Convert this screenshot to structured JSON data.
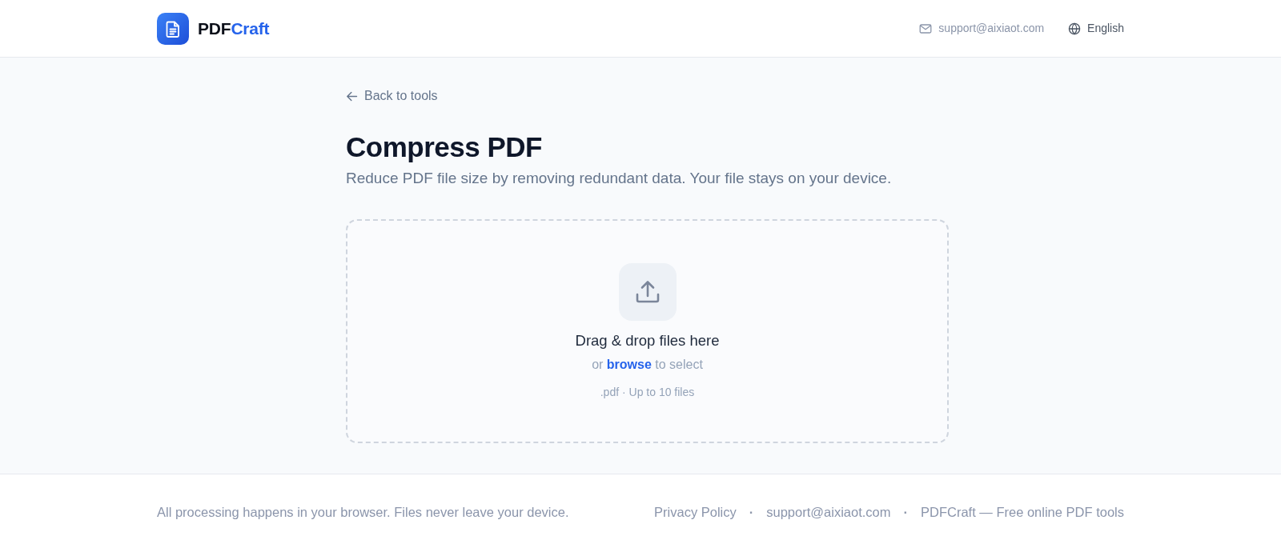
{
  "header": {
    "logo": {
      "brand": "PDF",
      "accent": "Craft"
    },
    "contact_email": "support@aixiaot.com",
    "language": "English"
  },
  "back_link": "Back to tools",
  "page": {
    "title": "Compress PDF",
    "subtitle": "Reduce PDF file size by removing redundant data. Your file stays on your device."
  },
  "dropzone": {
    "heading": "Drag & drop files here",
    "hint_before": "or",
    "link": "browse",
    "hint_after": "to select",
    "accepts": ".pdf · Up to 10 files"
  },
  "footer": {
    "note": "All processing happens in your browser. Files never leave your device.",
    "items": [
      {
        "kind": "link",
        "text": "Privacy Policy"
      },
      {
        "kind": "separator",
        "text": "·"
      },
      {
        "kind": "link",
        "text": "support@aixiaot.com"
      },
      {
        "kind": "separator",
        "text": "·"
      },
      {
        "kind": "text",
        "text": "PDFCraft — Free online PDF tools"
      }
    ]
  }
}
